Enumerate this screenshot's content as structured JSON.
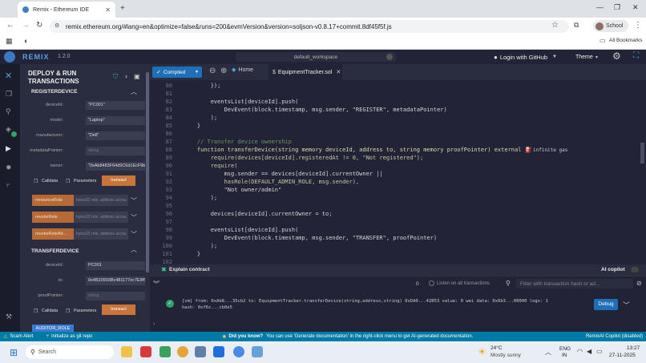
{
  "browser": {
    "tab_title": "Remix - Ethereum IDE",
    "url": "remix.ethereum.org/#lang=en&optimize=false&runs=200&evmVersion&version=soljson-v0.8.17+commit.8df45f5f.js",
    "profile_label": "School",
    "bookmarks_label": "All Bookmarks"
  },
  "remix": {
    "logo": "REMIX",
    "version": "1.2.0",
    "workspace": "default_workspace",
    "login_label": "Login with GitHub",
    "theme_label": "Theme"
  },
  "side_panel": {
    "title_line1": "DEPLOY & RUN",
    "title_line2": "TRANSACTIONS",
    "register": {
      "title": "REGISTERDEVICE",
      "fields": [
        {
          "label": "deviceId:",
          "value": "\"PC001\""
        },
        {
          "label": "model:",
          "value": "\"Laptop\""
        },
        {
          "label": "manufacturer:",
          "value": "\"Dell\""
        },
        {
          "label": "metadataPointer:",
          "value": "string"
        },
        {
          "label": "owner:",
          "value": "\"0xAb8483F64d9C6d1EcF9b849Ae6"
        }
      ],
      "calldata": "Calldata",
      "parameters": "Parameters",
      "transact": "transact"
    },
    "roles": [
      {
        "label": "renounceRole",
        "placeholder": "bytes32 role, address accou"
      },
      {
        "label": "revokeRole",
        "placeholder": "bytes32 role, address accou"
      },
      {
        "label": "revokeRoleAd...",
        "placeholder": "bytes32 role, address accou"
      }
    ],
    "transfer": {
      "title": "TRANSFERDEVICE",
      "fields": [
        {
          "label": "deviceId:",
          "value": "PC001"
        },
        {
          "label": "to:",
          "value": "0x4B20993Bc481177ec7E8f571ceCa"
        },
        {
          "label": "proofPointer:",
          "value": "string"
        }
      ],
      "calldata": "Calldata",
      "parameters": "Parameters",
      "transact": "transact"
    },
    "auditor_role": "AUDITOR_ROLE"
  },
  "editor": {
    "compiled_label": "Compiled",
    "tabs": [
      {
        "label": "Home"
      },
      {
        "label": "EquipmentTracker.sol"
      }
    ],
    "gas_hint": "infinite gas",
    "lines": [
      {
        "n": "80",
        "text": "        });"
      },
      {
        "n": "81",
        "text": ""
      },
      {
        "n": "82",
        "text": "        eventsList[deviceId].push("
      },
      {
        "n": "83",
        "text": "            DevEvent(block.timestamp, msg.sender, \"REGISTER\", metadataPointer)"
      },
      {
        "n": "84",
        "text": "        );"
      },
      {
        "n": "85",
        "text": "    }"
      },
      {
        "n": "86",
        "text": ""
      },
      {
        "n": "87",
        "text": "    // Transfer device ownership"
      },
      {
        "n": "88",
        "text": "    function transferDevice(string memory deviceId, address to, string memory proofPointer) external {"
      },
      {
        "n": "89",
        "text": "        require(devices[deviceId].registeredAt != 0, \"Not registered\");"
      },
      {
        "n": "90",
        "text": "        require("
      },
      {
        "n": "91",
        "text": "            msg.sender == devices[deviceId].currentOwner ||"
      },
      {
        "n": "92",
        "text": "            hasRole(DEFAULT_ADMIN_ROLE, msg.sender),"
      },
      {
        "n": "93",
        "text": "            \"Not owner/admin\""
      },
      {
        "n": "94",
        "text": "        );"
      },
      {
        "n": "95",
        "text": ""
      },
      {
        "n": "96",
        "text": "        devices[deviceId].currentOwner = to;"
      },
      {
        "n": "97",
        "text": ""
      },
      {
        "n": "98",
        "text": "        eventsList[deviceId].push("
      },
      {
        "n": "99",
        "text": "            DevEvent(block.timestamp, msg.sender, \"TRANSFER\", proofPointer)"
      },
      {
        "n": "100",
        "text": "        );"
      },
      {
        "n": "101",
        "text": "    }"
      },
      {
        "n": "102",
        "text": ""
      }
    ]
  },
  "explain": {
    "label": "Explain contract",
    "ai_copilot": "AI copilot"
  },
  "terminal": {
    "count": "0",
    "listen_label": "Listen on all transactions",
    "filter_placeholder": "Filter with transaction hash or ad...",
    "tx_line1": "[vm] from: 0xAb8...35cb2 to: EquipmentTracker.transferDevice(string,address,string) 0xDA0...42B53 value: 0 wei data: 0x6b3...00000 logs: 1",
    "tx_line2": "hash: 0xf6c...cb0e5",
    "debug_label": "Debug"
  },
  "statusbar": {
    "scam_alert": "Scam Alert",
    "git_repo": "Initialize as git repo",
    "did_you_know": "Did you know?",
    "tip": "You can use 'Generate documentation' in the right-click menu to get AI-generated documentation.",
    "copilot": "RemixAI Copilot (disabled)"
  },
  "taskbar": {
    "search_label": "Search",
    "weather_temp": "24°C",
    "weather_desc": "Mostly sunny",
    "lang1": "ENG",
    "lang2": "IN",
    "time": "13:27",
    "date": "27-11-2025"
  },
  "colors": {
    "remix_dark": "#222336",
    "panel": "#2a2c3f",
    "accent_orange": "#c97539",
    "accent_blue": "#007aa6",
    "compiled_blue": "#1f6fb8"
  }
}
